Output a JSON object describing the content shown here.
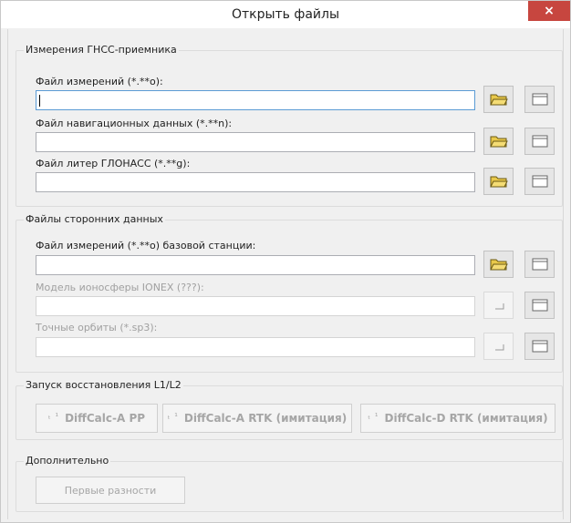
{
  "window": {
    "title": "Открыть файлы",
    "close_label": "×"
  },
  "gnss_group": {
    "legend": "Измерения ГНСС-приемника",
    "fields": [
      {
        "label": "Файл измерений (*.**o):",
        "value": ""
      },
      {
        "label": "Файл навигационных данных (*.**n):",
        "value": ""
      },
      {
        "label": "Файл литер ГЛОНАСС (*.**g):",
        "value": ""
      }
    ]
  },
  "external_group": {
    "legend": "Файлы сторонних данных",
    "fields": [
      {
        "label": "Файл измерений (*.**o) базовой станции:",
        "value": ""
      },
      {
        "label": "Модель ионосферы IONEX (???):",
        "value": ""
      },
      {
        "label": "Точные орбиты (*.sp3):",
        "value": ""
      }
    ]
  },
  "run_group": {
    "legend": "Запуск восстановления L1/L2",
    "prefix": "ₜ ¹",
    "buttons": [
      "DiffCalc-A PP",
      "DiffCalc-A RTK (имитация)",
      "DiffCalc-D RTK (имитация)"
    ]
  },
  "extra_group": {
    "legend": "Дополнительно",
    "button": "Первые разности"
  },
  "icons": {
    "open": "folder-open-icon",
    "browse": "window-icon",
    "disabled_browse": "small-corner-icon"
  },
  "colors": {
    "close_bg": "#c7463f",
    "folder": "#e8c84a",
    "focus_border": "#5b9bd5"
  }
}
